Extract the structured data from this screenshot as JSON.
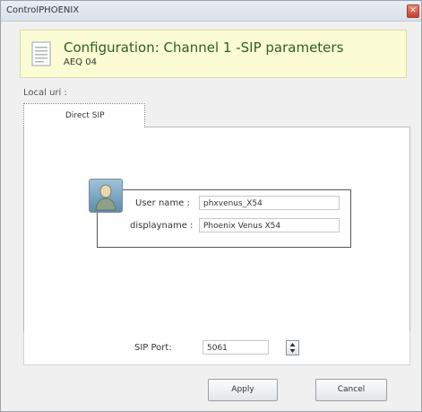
{
  "window": {
    "title": "ControlPHOENIX",
    "close_label": "✕"
  },
  "header": {
    "title": "Configuration: Channel 1 -SIP parameters",
    "subtitle": "AEQ 04"
  },
  "local_uri_label": "Local uri :",
  "tabs": [
    {
      "label": "Direct SIP",
      "active": true
    }
  ],
  "user": {
    "username_label": "User name :",
    "username_value": "phxvenus_X54",
    "displayname_label": "displayname :",
    "displayname_value": "Phoenix Venus X54"
  },
  "sip_port": {
    "label": "SIP Port:",
    "value": "5061"
  },
  "buttons": {
    "apply": "Apply",
    "cancel": "Cancel"
  },
  "colors": {
    "banner_bg": "#fbfcd3",
    "banner_title": "#2d5d2a"
  }
}
